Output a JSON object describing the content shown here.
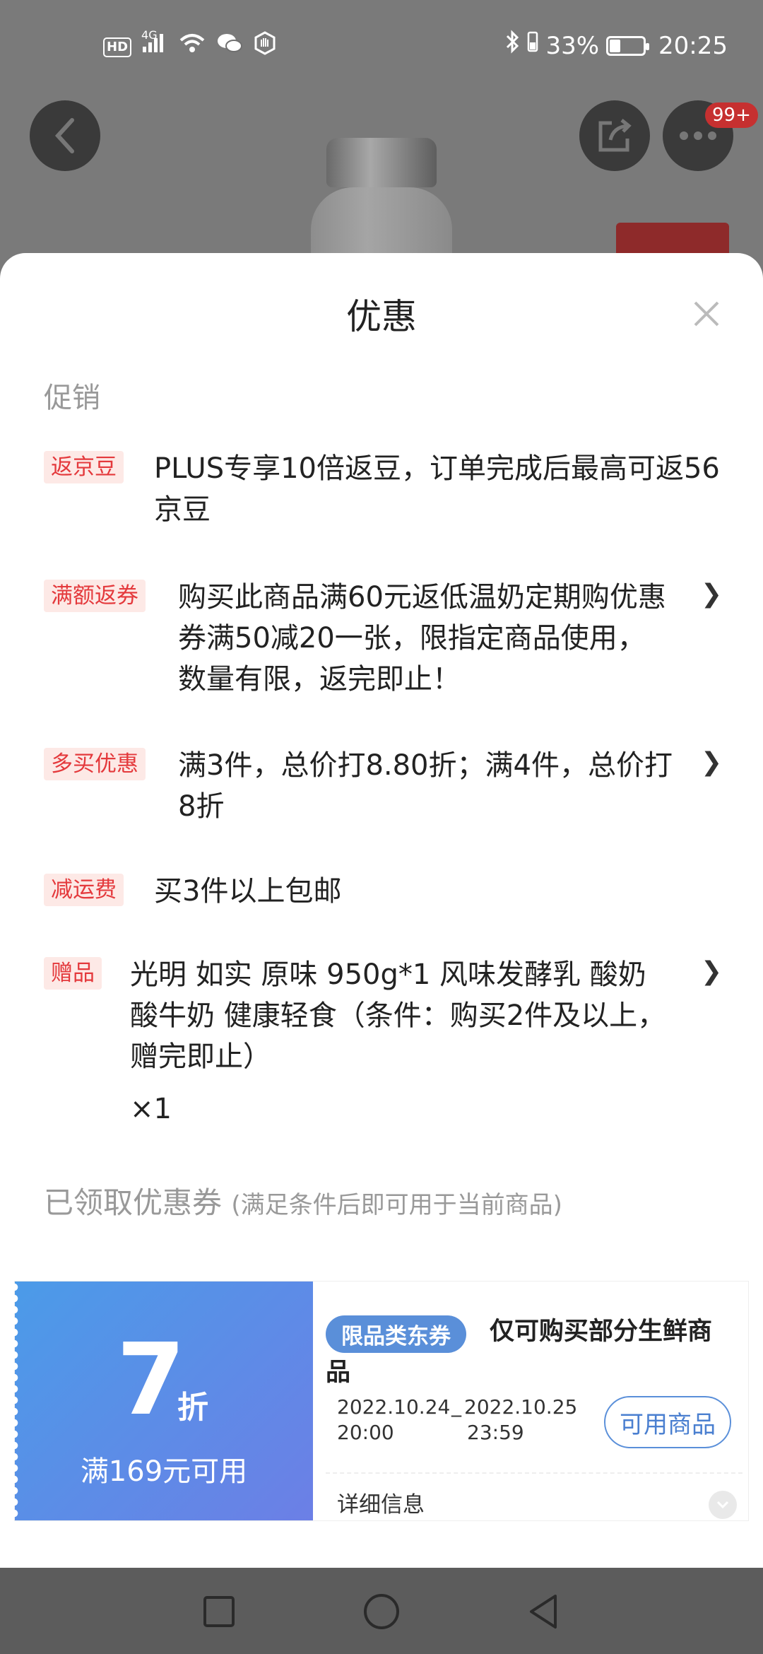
{
  "status_bar": {
    "hd": "HD",
    "network": "4G",
    "battery_text": "33%",
    "battery_level": 0.33,
    "time": "20:25"
  },
  "header": {
    "notification_badge": "99+"
  },
  "sheet": {
    "title": "优惠",
    "promotions_label": "促销",
    "promotions": [
      {
        "tag": "返京豆",
        "text": "PLUS专享10倍返豆，订单完成后最高可返56京豆",
        "has_chevron": false
      },
      {
        "tag": "满额返券",
        "text": "购买此商品满60元返低温奶定期购优惠券满50减20一张，限指定商品使用，数量有限，返完即止！",
        "has_chevron": true
      },
      {
        "tag": "多买优惠",
        "text": "满3件，总价打8.80折；满4件，总价打8折",
        "has_chevron": true
      },
      {
        "tag": "减运费",
        "text": "买3件以上包邮",
        "has_chevron": false
      },
      {
        "tag": "赠品",
        "text": "光明 如实 原味 950g*1 风味发酵乳 酸奶酸牛奶 健康轻食（条件：购买2件及以上，赠完即止）",
        "quantity": "×1",
        "has_chevron": true
      }
    ],
    "coupons_title": "已领取优惠券",
    "coupons_subtitle": "(满足条件后即可用于当前商品)",
    "coupon": {
      "discount": "7",
      "unit": "折",
      "condition": "满169元可用",
      "category_tag": "限品类东券",
      "description": "仅可购买部分生鲜商品",
      "start_date": "2022.10.24",
      "start_time": "20:00",
      "end_date": "2022.10.25",
      "end_time": "23:59",
      "separator": "_",
      "button_label": "可用商品",
      "detail_label": "详细信息"
    }
  },
  "colors": {
    "accent_red": "#e4393c",
    "coupon_blue": "#5a8fd9"
  }
}
